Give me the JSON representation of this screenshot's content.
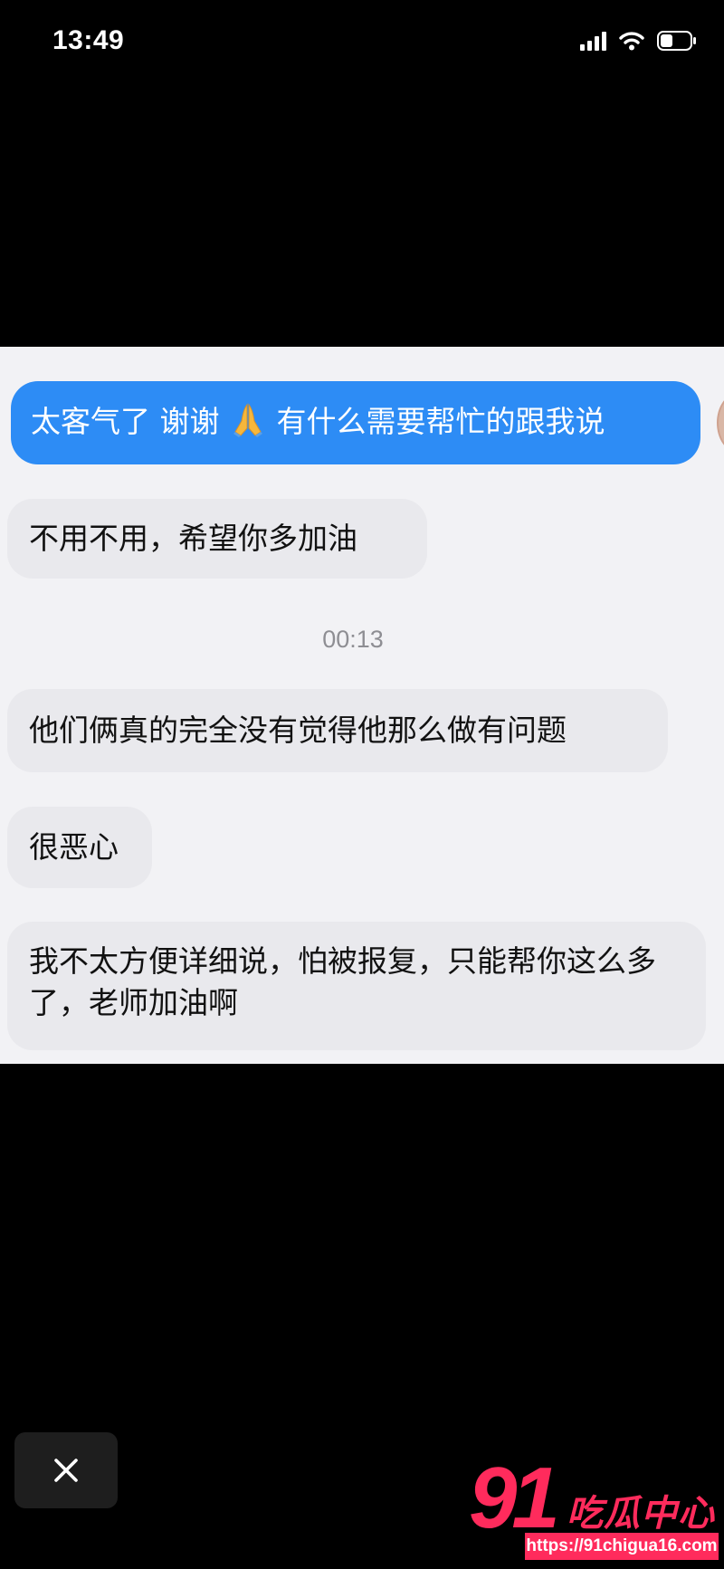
{
  "status_bar": {
    "time": "13:49",
    "icons": [
      "cellular-signal-icon",
      "wifi-icon",
      "battery-icon"
    ]
  },
  "chat": {
    "outgoing": [
      {
        "text_before": "太客气了 谢谢",
        "emoji": "pray-icon",
        "text_after": "有什么需要帮忙的跟我说"
      }
    ],
    "messages": [
      {
        "text": "不用不用，希望你多加油"
      },
      {
        "timestamp": "00:13"
      },
      {
        "text": "他们俩真的完全没有觉得他那么做有问题"
      },
      {
        "text": "很恶心"
      },
      {
        "text": "我不太方便详细说，怕被报复，只能帮你这么多了，老师加油啊"
      }
    ]
  },
  "controls": {
    "close_icon": "close-icon"
  },
  "watermark": {
    "number": "91",
    "text": "吃瓜中心",
    "url": "https://91chigua16.com"
  },
  "colors": {
    "outgoing_bubble": "#2d8cf5",
    "incoming_bubble": "#e9e9ed",
    "chat_background": "#f2f2f5",
    "watermark": "#ff2b5c",
    "page_background": "#000000"
  }
}
